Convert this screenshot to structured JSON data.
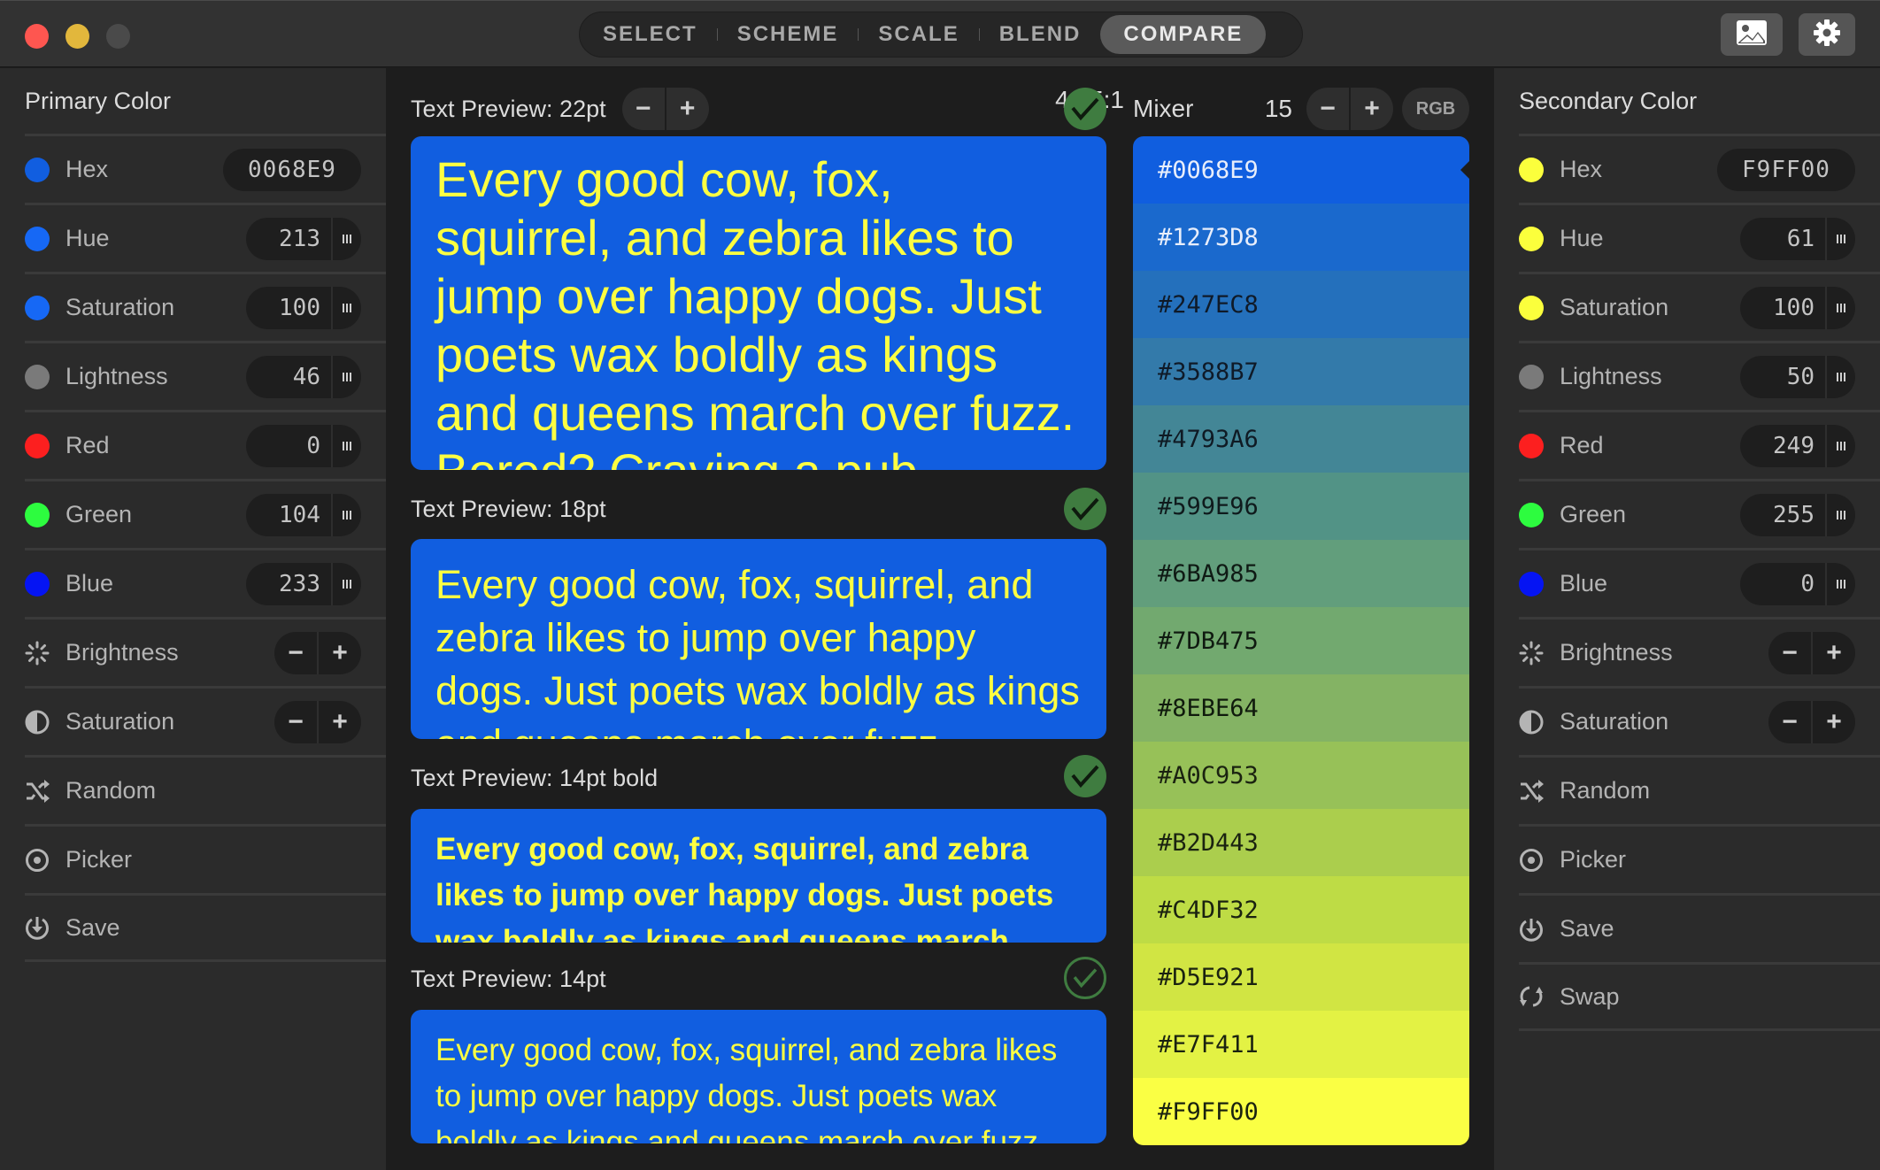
{
  "window": {
    "tabs": [
      {
        "label": "SELECT",
        "active": false
      },
      {
        "label": "SCHEME",
        "active": false
      },
      {
        "label": "SCALE",
        "active": false
      },
      {
        "label": "BLEND",
        "active": false
      },
      {
        "label": "COMPARE",
        "active": true
      }
    ],
    "toolbar_icons": [
      "image-icon",
      "gear-icon"
    ]
  },
  "primary": {
    "title": "Primary Color",
    "swatch_color": "#0068E9",
    "hex": {
      "label": "Hex",
      "value": "0068E9"
    },
    "hue": {
      "label": "Hue",
      "value": "213"
    },
    "saturation": {
      "label": "Saturation",
      "value": "100"
    },
    "lightness": {
      "label": "Lightness",
      "value": "46"
    },
    "red": {
      "label": "Red",
      "value": "0"
    },
    "green": {
      "label": "Green",
      "value": "104"
    },
    "blue": {
      "label": "Blue",
      "value": "233"
    },
    "brightness_adjust": {
      "label": "Brightness"
    },
    "saturation_adjust": {
      "label": "Saturation"
    },
    "random": {
      "label": "Random"
    },
    "picker": {
      "label": "Picker"
    },
    "save": {
      "label": "Save"
    }
  },
  "secondary": {
    "title": "Secondary Color",
    "swatch_color": "#F9FF00",
    "hex": {
      "label": "Hex",
      "value": "F9FF00"
    },
    "hue": {
      "label": "Hue",
      "value": "61"
    },
    "saturation": {
      "label": "Saturation",
      "value": "100"
    },
    "lightness": {
      "label": "Lightness",
      "value": "50"
    },
    "red": {
      "label": "Red",
      "value": "249"
    },
    "green": {
      "label": "Green",
      "value": "255"
    },
    "blue": {
      "label": "Blue",
      "value": "0"
    },
    "brightness_adjust": {
      "label": "Brightness"
    },
    "saturation_adjust": {
      "label": "Saturation"
    },
    "random": {
      "label": "Random"
    },
    "picker": {
      "label": "Picker"
    },
    "save": {
      "label": "Save"
    },
    "swap": {
      "label": "Swap"
    }
  },
  "indicator_colors": {
    "hue_sat": "#1668f5",
    "hue_sat_secondary": "#fbff3c",
    "lightness": "#7a7a7a",
    "red": "#fc1f1f",
    "green": "#2dfc3f",
    "blue": "#0514f3"
  },
  "controls": {
    "minus": "−",
    "plus": "+"
  },
  "compare": {
    "contrast_ratio": "4.65:1",
    "previews": [
      {
        "label": "Text Preview: 22pt",
        "pass": true,
        "style": "filled",
        "text": "Every good cow, fox, squirrel, and zebra likes to jump over happy dogs. Just poets wax boldly as kings and queens march over fuzz. Bored? Craving a pub"
      },
      {
        "label": "Text Preview: 18pt",
        "pass": true,
        "style": "filled",
        "text": "Every good cow, fox, squirrel, and zebra likes to jump over happy dogs. Just poets wax boldly as kings and queens march over fuzz."
      },
      {
        "label": "Text Preview: 14pt bold",
        "pass": true,
        "style": "filled",
        "text": "Every good cow, fox, squirrel, and zebra likes to jump over happy dogs. Just poets wax boldly as kings and queens march over fuzz."
      },
      {
        "label": "Text Preview: 14pt",
        "pass": true,
        "style": "outline",
        "text": "Every good cow, fox, squirrel, and zebra likes to jump over happy dogs. Just poets wax boldly as kings and queens march over fuzz."
      }
    ],
    "background_color": "#115EE0",
    "text_color": "#FCFF42"
  },
  "mixer": {
    "title": "Mixer",
    "steps": "15",
    "mode": "RGB",
    "swatches": [
      {
        "hex": "#0068E9",
        "bg": "#105EDF",
        "fg": "#e8eefb",
        "selected": true
      },
      {
        "hex": "#1273D8",
        "bg": "#1A69CD",
        "fg": "#e8eefb"
      },
      {
        "hex": "#247EC8",
        "bg": "#2470BC",
        "fg": "#0f1a28"
      },
      {
        "hex": "#3588B7",
        "bg": "#337AAA",
        "fg": "#0f1a28"
      },
      {
        "hex": "#4793A6",
        "bg": "#438696",
        "fg": "#0f1a24"
      },
      {
        "hex": "#599E96",
        "bg": "#529386",
        "fg": "#0f1a1c"
      },
      {
        "hex": "#6BA985",
        "bg": "#629E7C",
        "fg": "#0f1a14"
      },
      {
        "hex": "#7DB475",
        "bg": "#72A96F",
        "fg": "#0f1a10"
      },
      {
        "hex": "#8EBE64",
        "bg": "#84B364",
        "fg": "#0f1a0c"
      },
      {
        "hex": "#A0C953",
        "bg": "#97C158",
        "fg": "#1a2210"
      },
      {
        "hex": "#B2D443",
        "bg": "#ABCE4D",
        "fg": "#1a2210"
      },
      {
        "hex": "#C4DF32",
        "bg": "#BEDC45",
        "fg": "#1a2210"
      },
      {
        "hex": "#D5E921",
        "bg": "#D1E543",
        "fg": "#1a2210"
      },
      {
        "hex": "#E7F411",
        "bg": "#E3F244",
        "fg": "#1a2210"
      },
      {
        "hex": "#F9FF00",
        "bg": "#FAFF44",
        "fg": "#1a2210"
      }
    ]
  }
}
